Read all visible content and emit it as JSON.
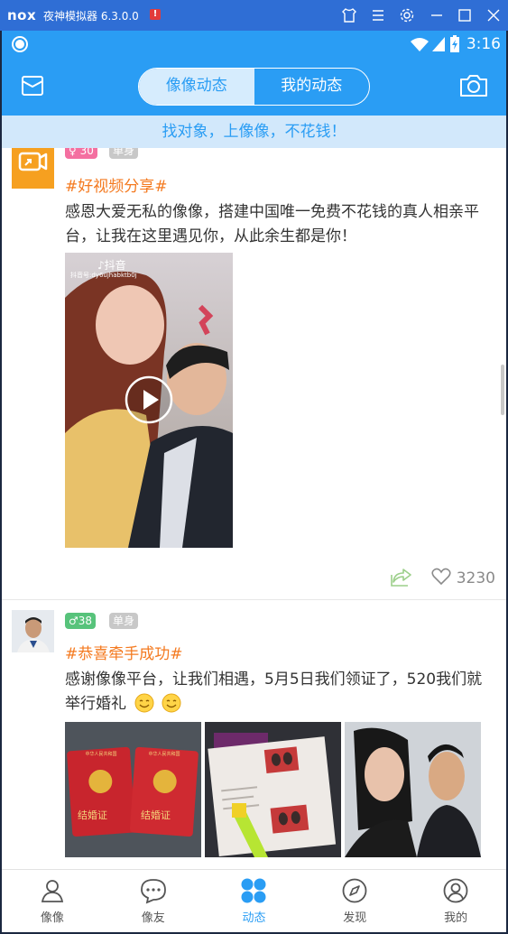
{
  "window": {
    "logo": "nox",
    "title": "夜神模拟器 6.3.0.0",
    "alert": "!"
  },
  "status": {
    "time": "3:16"
  },
  "header": {
    "tabs": [
      {
        "label": "像像动态",
        "active": true
      },
      {
        "label": "我的动态",
        "active": false
      }
    ]
  },
  "banner": {
    "text": "找对象，上像像，不花钱！"
  },
  "posts": [
    {
      "age": "30",
      "status": "单身",
      "tag": "#好视频分享#",
      "text": "感恩大爱无私的像像，搭建中国唯一免费不花钱的真人相亲平台，让我在这里遇见你，从此余生都是你！",
      "video_watermark": "抖音",
      "video_id": "抖音号:dy6ujhabktb0j",
      "likes": "3230"
    },
    {
      "gender_symbol": "♂",
      "age": "38",
      "status": "单身",
      "tag": "#恭喜牵手成功#",
      "text": "感谢像像平台，让我们相遇，5月5日我们领证了，520我们就举行婚礼",
      "photo_text": "结婚证",
      "photo_heading": "中华人民共和国"
    }
  ],
  "nav": [
    {
      "label": "像像",
      "icon": "person-icon"
    },
    {
      "label": "像友",
      "icon": "chat-bubble-icon"
    },
    {
      "label": "动态",
      "icon": "dots-grid-icon",
      "active": true
    },
    {
      "label": "发现",
      "icon": "compass-icon"
    },
    {
      "label": "我的",
      "icon": "profile-icon"
    }
  ],
  "colors": {
    "accent": "#2a9df4",
    "tag": "#f47a20",
    "female": "#f46fa0",
    "male": "#57c37b"
  }
}
